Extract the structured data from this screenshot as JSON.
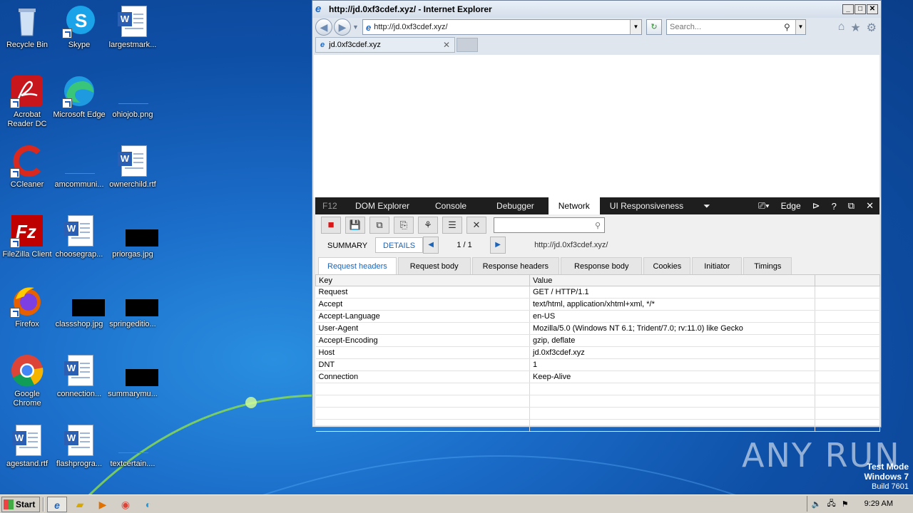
{
  "desktop": {
    "icons": [
      {
        "label": "Recycle Bin"
      },
      {
        "label": "Skype"
      },
      {
        "label": "largestmark..."
      },
      {
        "label": "Acrobat Reader DC"
      },
      {
        "label": "Microsoft Edge"
      },
      {
        "label": "ohiojob.png"
      },
      {
        "label": "CCleaner"
      },
      {
        "label": "amcommuni..."
      },
      {
        "label": "ownerchild.rtf"
      },
      {
        "label": "FileZilla Client"
      },
      {
        "label": "choosegrap..."
      },
      {
        "label": "priorgas.jpg"
      },
      {
        "label": "Firefox"
      },
      {
        "label": "classshop.jpg"
      },
      {
        "label": "springeditio..."
      },
      {
        "label": "Google Chrome"
      },
      {
        "label": "connection..."
      },
      {
        "label": "summarymu..."
      },
      {
        "label": "agestand.rtf"
      },
      {
        "label": "flashprogra..."
      },
      {
        "label": "textcertain...."
      }
    ]
  },
  "browser": {
    "window_title": "http://jd.0xf3cdef.xyz/ - Internet Explorer",
    "address": "http://jd.0xf3cdef.xyz/",
    "search_placeholder": "Search...",
    "tab_label": "jd.0xf3cdef.xyz",
    "window_buttons": {
      "minimize": "_",
      "maximize": "□",
      "close": "✕"
    }
  },
  "devtools": {
    "f12_label": "F12",
    "tabs": [
      "DOM Explorer",
      "Console",
      "Debugger",
      "Network",
      "UI Responsiveness"
    ],
    "active_tab": "Network",
    "mode": "Edge",
    "subtabs": {
      "summary": "SUMMARY",
      "details": "DETAILS"
    },
    "page_count": "1 / 1",
    "request_url": "http://jd.0xf3cdef.xyz/",
    "detail_tabs": [
      "Request headers",
      "Request body",
      "Response headers",
      "Response body",
      "Cookies",
      "Initiator",
      "Timings"
    ],
    "table_headers": {
      "key": "Key",
      "value": "Value"
    },
    "headers": [
      {
        "key": "Request",
        "value": "GET / HTTP/1.1"
      },
      {
        "key": "Accept",
        "value": "text/html, application/xhtml+xml, */*"
      },
      {
        "key": "Accept-Language",
        "value": "en-US"
      },
      {
        "key": "User-Agent",
        "value": "Mozilla/5.0 (Windows NT 6.1; Trident/7.0; rv:11.0) like Gecko"
      },
      {
        "key": "Accept-Encoding",
        "value": "gzip, deflate"
      },
      {
        "key": "Host",
        "value": "jd.0xf3cdef.xyz"
      },
      {
        "key": "DNT",
        "value": "1"
      },
      {
        "key": "Connection",
        "value": "Keep-Alive"
      }
    ]
  },
  "watermark": "ANY RUN",
  "os_notice": {
    "line1": "Test Mode",
    "line2": "Windows 7",
    "line3": "Build 7601"
  },
  "taskbar": {
    "start_label": "Start",
    "clock": "9:29 AM"
  }
}
